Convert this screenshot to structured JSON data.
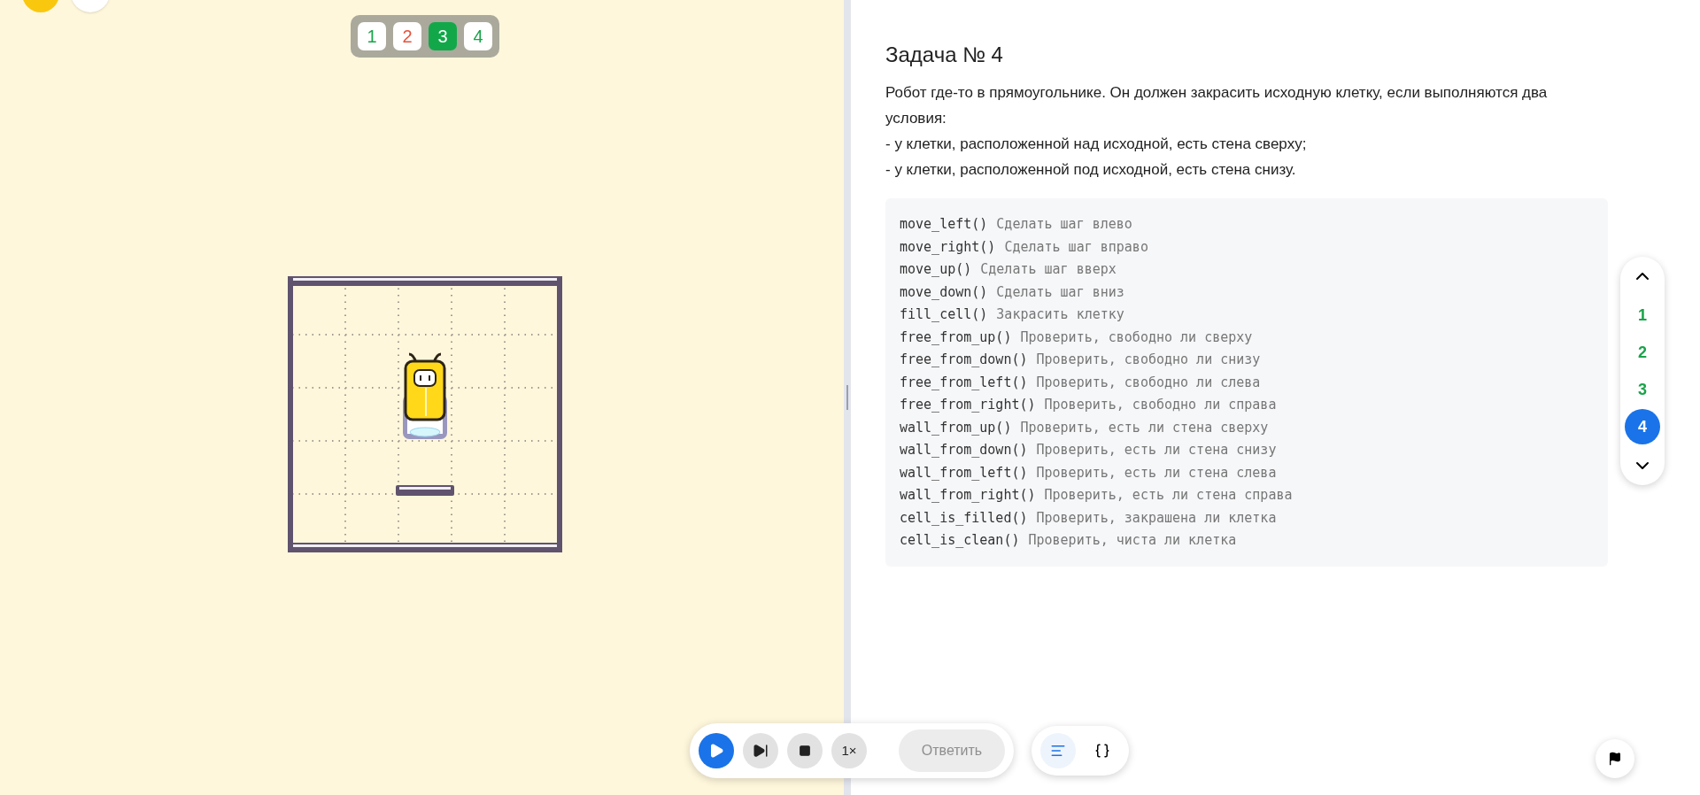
{
  "levels": [
    {
      "label": "1",
      "color": "#1aa34a",
      "selected": false
    },
    {
      "label": "2",
      "color": "#e5533c",
      "selected": false
    },
    {
      "label": "3",
      "color": "#12a84a",
      "selected": true
    },
    {
      "label": "4",
      "color": "#1aa34a",
      "selected": false
    }
  ],
  "task": {
    "title": "Задача № 4",
    "paragraphs": [
      "Робот где-то в прямоугольнике. Он должен закрасить исходную клетку, если выполняются два условия:",
      "- у клетки, расположенной над исходной, есть стена сверху;",
      "- у клетки, расположенной под исходной, есть стена снизу."
    ]
  },
  "commands": [
    {
      "name": "move_left()",
      "description": "Сделать шаг влево"
    },
    {
      "name": "move_right()",
      "description": "Сделать шаг вправо"
    },
    {
      "name": "move_up()",
      "description": "Сделать шаг вверх"
    },
    {
      "name": "move_down()",
      "description": "Сделать шаг вниз"
    },
    {
      "name": "fill_cell()",
      "description": "Закрасить клетку"
    },
    {
      "name": "free_from_up()",
      "description": "Проверить, свободно ли сверху"
    },
    {
      "name": "free_from_down()",
      "description": "Проверить, свободно ли снизу"
    },
    {
      "name": "free_from_left()",
      "description": "Проверить, свободно ли слева"
    },
    {
      "name": "free_from_right()",
      "description": "Проверить, свободно ли справа"
    },
    {
      "name": "wall_from_up()",
      "description": "Проверить, есть ли стена сверху"
    },
    {
      "name": "wall_from_down()",
      "description": "Проверить, есть ли стена снизу"
    },
    {
      "name": "wall_from_left()",
      "description": "Проверить, есть ли стена слева"
    },
    {
      "name": "wall_from_right()",
      "description": "Проверить, есть ли стена справа"
    },
    {
      "name": "cell_is_filled()",
      "description": "Проверить, закрашена ли клетка"
    },
    {
      "name": "cell_is_clean()",
      "description": "Проверить, чиста ли клетка"
    }
  ],
  "task_nav": [
    {
      "label": "1",
      "color": "#1aa34a",
      "selected": false
    },
    {
      "label": "2",
      "color": "#1aa34a",
      "selected": false
    },
    {
      "label": "3",
      "color": "#1aa34a",
      "selected": false
    },
    {
      "label": "4",
      "selected": true
    }
  ],
  "toolbar": {
    "speed": "1×",
    "answer": {
      "label": "Ответить",
      "disabled": true
    }
  },
  "view_tabs": [
    {
      "kind": "text",
      "selected": true
    },
    {
      "kind": "code",
      "selected": false
    }
  ]
}
